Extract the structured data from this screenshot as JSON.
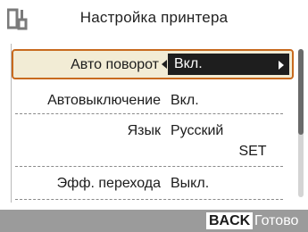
{
  "header": {
    "title": "Настройка принтера",
    "icon": "printer-settings-icon"
  },
  "settings": {
    "items": [
      {
        "label": "Авто поворот",
        "value": "Вкл.",
        "selected": true
      },
      {
        "label": "Автовыключение",
        "value": "Вкл."
      },
      {
        "label": "Язык",
        "value": "Русский"
      },
      {
        "label": "Эфф. перехода",
        "value": "Выкл."
      }
    ],
    "set_label": "SET"
  },
  "footer": {
    "back_label": "BACK",
    "back_text": "Готово"
  },
  "colors": {
    "accent": "#c86a1e",
    "selected_bg": "#f2ecd5",
    "value_box": "#1e1e1e",
    "footer_bg": "#9b9b9b"
  }
}
